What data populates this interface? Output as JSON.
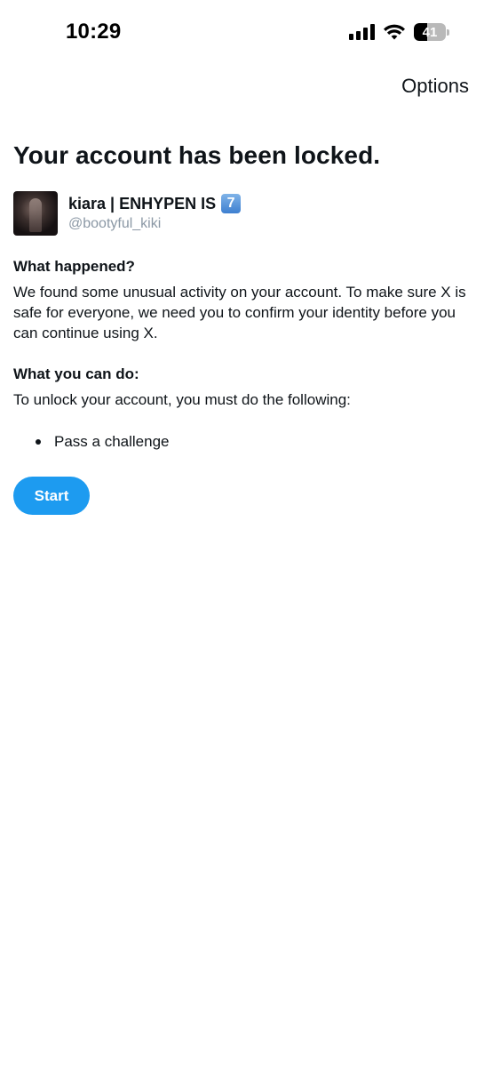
{
  "status_bar": {
    "time": "10:29",
    "battery_level": "41",
    "icons": [
      "cellular-signal-icon",
      "wifi-icon",
      "battery-icon"
    ]
  },
  "header": {
    "options_label": "Options"
  },
  "page": {
    "title": "Your account has been locked."
  },
  "account": {
    "display_name": "kiara | ENHYPEN IS",
    "badge": "7",
    "handle": "@bootyful_kiki"
  },
  "what_happened": {
    "heading": "What happened?",
    "body": "We found some unusual activity on your account. To make sure X is safe for everyone, we need you to confirm your identity before you can continue using X."
  },
  "what_you_can_do": {
    "heading": "What you can do:",
    "body": "To unlock your account, you must do the following:",
    "steps": [
      "Pass a challenge"
    ]
  },
  "actions": {
    "start_label": "Start"
  },
  "colors": {
    "accent": "#1d9bf0",
    "text": "#0f1419",
    "secondary_text": "#8b98a5"
  }
}
